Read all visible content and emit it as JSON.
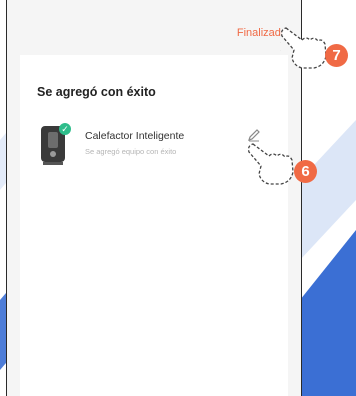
{
  "header": {
    "finish_label": "Finalizado"
  },
  "card": {
    "title": "Se agregó con éxito",
    "device": {
      "name": "Calefactor Inteligente",
      "status": "Se agregó equipo con éxito"
    }
  },
  "annotations": {
    "step_edit": "6",
    "step_finish": "7"
  },
  "colors": {
    "accent": "#f06a45",
    "success": "#2ebd8b",
    "stripe": "#3b6fd4"
  },
  "icons": [
    "heater-device-icon",
    "checkmark-icon",
    "pencil-edit-icon",
    "pointing-hand-icon"
  ]
}
